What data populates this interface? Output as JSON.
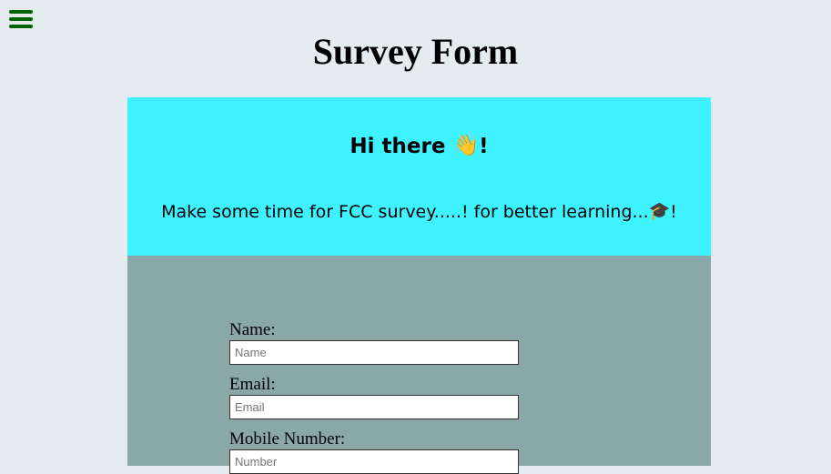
{
  "header": {
    "menu_icon": "hamburger-menu-icon",
    "title": "Survey Form"
  },
  "hero": {
    "heading": "Hi there",
    "heading_emoji": "👋",
    "heading_suffix": "!",
    "subtitle": "Make some time for FCC survey.....! for better learning...",
    "subtitle_emoji": "🎓",
    "subtitle_suffix": "!"
  },
  "form": {
    "name_label": "Name:",
    "name_placeholder": "Name",
    "email_label": "Email:",
    "email_placeholder": "Email",
    "mobile_label": "Mobile Number:",
    "mobile_placeholder": "Number"
  },
  "colors": {
    "background": "#e4ecef",
    "hero_background": "#3ff2ff",
    "form_background": "#8aa8a8",
    "menu_icon": "#006400"
  }
}
